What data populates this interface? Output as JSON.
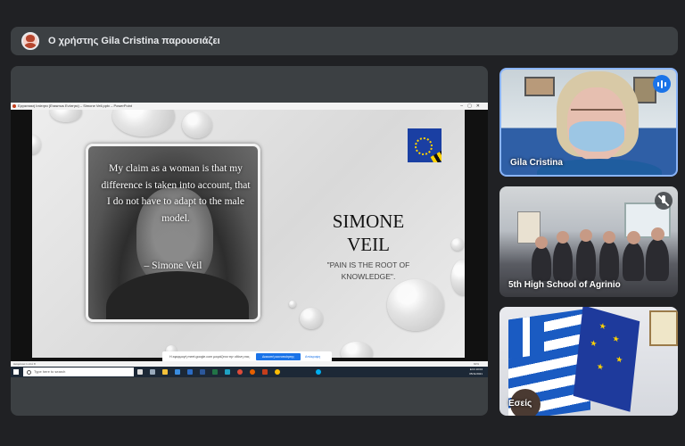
{
  "banner": {
    "presenter_text": "Ο χρήστης Gila Cristina παρουσιάζει"
  },
  "screen": {
    "ppt_window_title": "Εργασιακή Ισότητα (Erasmus Ενότητα) – Simone Veil.pptx – PowerPoint",
    "slide": {
      "quote_lines": [
        "My claim as a woman is that my",
        "difference is taken into account, that",
        "I do not have to adapt to the male",
        "model."
      ],
      "quote_author": "– Simone Veil",
      "title_line1": "SIMONE",
      "title_line2": "VEIL",
      "subtitle_line1": "\"PAIN IS THE ROOT OF",
      "subtitle_line2": "KNOWLEDGE\"."
    },
    "share_toast": {
      "text": "Η εφαρμογή meet.google.com μοιράζεται την οθόνη σας.",
      "button": "Διακοπή κοινοποίησης",
      "link": "Απόκρυψη"
    },
    "status_left": "Διαφάνεια 1 από 8",
    "zoom": "60%",
    "taskbar": {
      "search_placeholder": "Type here to search",
      "tray_line1": "ΕΛΛ 10:04",
      "tray_line2": "05/11/2021"
    }
  },
  "participants": [
    {
      "name": "Gila Cristina",
      "speaking": true
    },
    {
      "name": "5th High School of Agrinio",
      "muted": true
    },
    {
      "name": "Εσείς"
    }
  ],
  "colors": {
    "background": "#202124",
    "tile": "#3c4043",
    "active_speaker_border": "#8ab4f8",
    "speaking_badge": "#1a73e8"
  }
}
